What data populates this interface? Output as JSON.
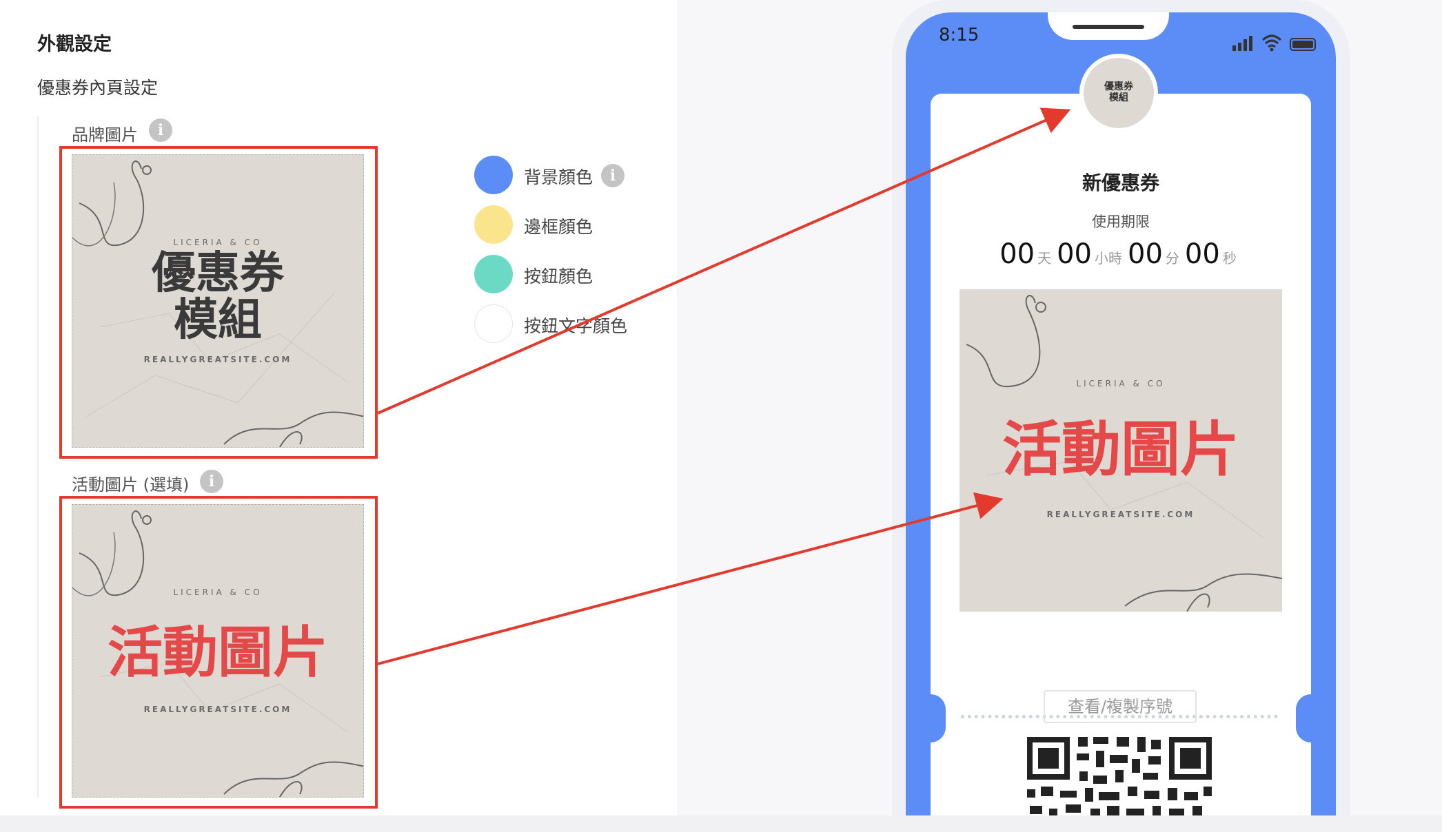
{
  "settings": {
    "title": "外觀設定",
    "subtitle": "優惠券內頁設定",
    "brand_image_label": "品牌圖片",
    "event_image_label": "活動圖片 (選填)",
    "info_glyph": "i"
  },
  "brand_image": {
    "top_text": "LICERIA & CO",
    "main_line1": "優惠券",
    "main_line2": "模組",
    "site_text": "REALLYGREATSITE.COM"
  },
  "event_image": {
    "top_text": "LICERIA & CO",
    "main_text": "活動圖片",
    "site_text": "REALLYGREATSITE.COM"
  },
  "colors": [
    {
      "label": "背景顏色",
      "value": "#5c8df6",
      "has_info": true
    },
    {
      "label": "邊框顏色",
      "value": "#fbe58c",
      "has_info": false
    },
    {
      "label": "按鈕顏色",
      "value": "#6cd9c4",
      "has_info": false
    },
    {
      "label": "按鈕文字顏色",
      "value": "#ffffff",
      "has_info": false
    }
  ],
  "phone": {
    "time": "8:15",
    "coupon_name": "新優惠券",
    "expiry_label": "使用期限",
    "countdown": [
      {
        "num": "00",
        "unit": "天"
      },
      {
        "num": "00",
        "unit": "小時"
      },
      {
        "num": "00",
        "unit": "分"
      },
      {
        "num": "00",
        "unit": "秒"
      }
    ],
    "serial_button": "查看/複製序號",
    "brand_logo_line1": "優惠券",
    "brand_logo_line2": "模組"
  }
}
